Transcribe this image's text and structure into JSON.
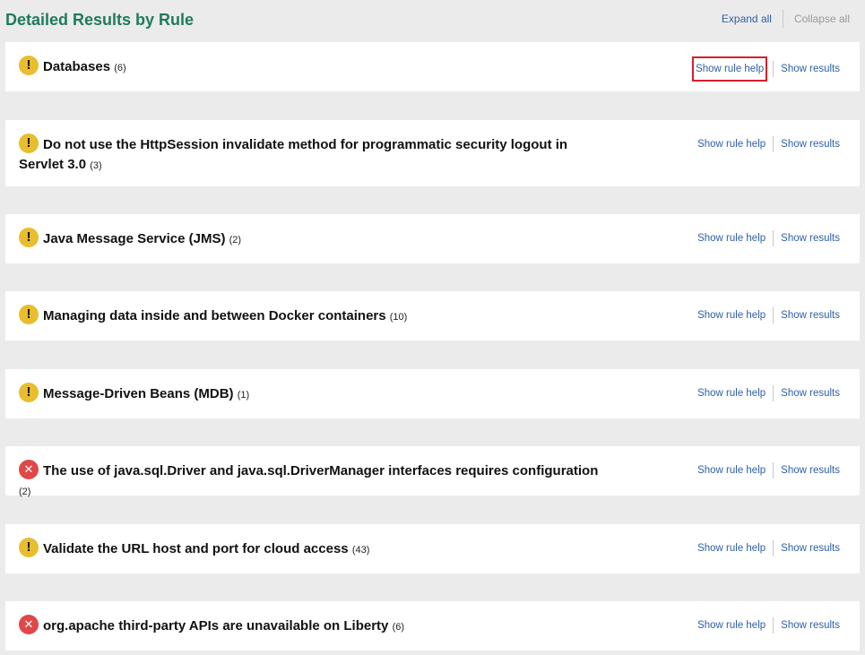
{
  "page": {
    "title": "Detailed Results by Rule",
    "expand_all": "Expand all",
    "collapse_all": "Collapse all"
  },
  "colors": {
    "title_green": "#1f7a5e",
    "link_blue": "#2f5fa8",
    "warning_yellow": "#e8bd2e",
    "error_red": "#e04848",
    "highlight_red": "#d8202a"
  },
  "rules": [
    {
      "status": "warning",
      "icon": "warning-icon",
      "title": "Databases",
      "count": "(6)",
      "help": "Show rule help",
      "results": "Show results"
    },
    {
      "status": "warning",
      "icon": "warning-icon",
      "title": "Do not use the HttpSession invalidate method for programmatic security logout in Servlet 3.0",
      "count": "(3)",
      "help": "Show rule help",
      "results": "Show results"
    },
    {
      "status": "warning",
      "icon": "warning-icon",
      "title": "Java Message Service (JMS)",
      "count": "(2)",
      "help": "Show rule help",
      "results": "Show results"
    },
    {
      "status": "warning",
      "icon": "warning-icon",
      "title": "Managing data inside and between Docker containers",
      "count": "(10)",
      "help": "Show rule help",
      "results": "Show results"
    },
    {
      "status": "warning",
      "icon": "warning-icon",
      "title": "Message-Driven Beans (MDB)",
      "count": "(1)",
      "help": "Show rule help",
      "results": "Show results"
    },
    {
      "status": "error",
      "icon": "error-icon",
      "title": "The use of java.sql.Driver and java.sql.DriverManager interfaces requires configuration",
      "count": "(2)",
      "help": "Show rule help",
      "results": "Show results"
    },
    {
      "status": "warning",
      "icon": "warning-icon",
      "title": "Validate the URL host and port for cloud access",
      "count": "(43)",
      "help": "Show rule help",
      "results": "Show results"
    },
    {
      "status": "error",
      "icon": "error-icon",
      "title": "org.apache third-party APIs are unavailable on Liberty",
      "count": "(6)",
      "help": "Show rule help",
      "results": "Show results"
    }
  ]
}
